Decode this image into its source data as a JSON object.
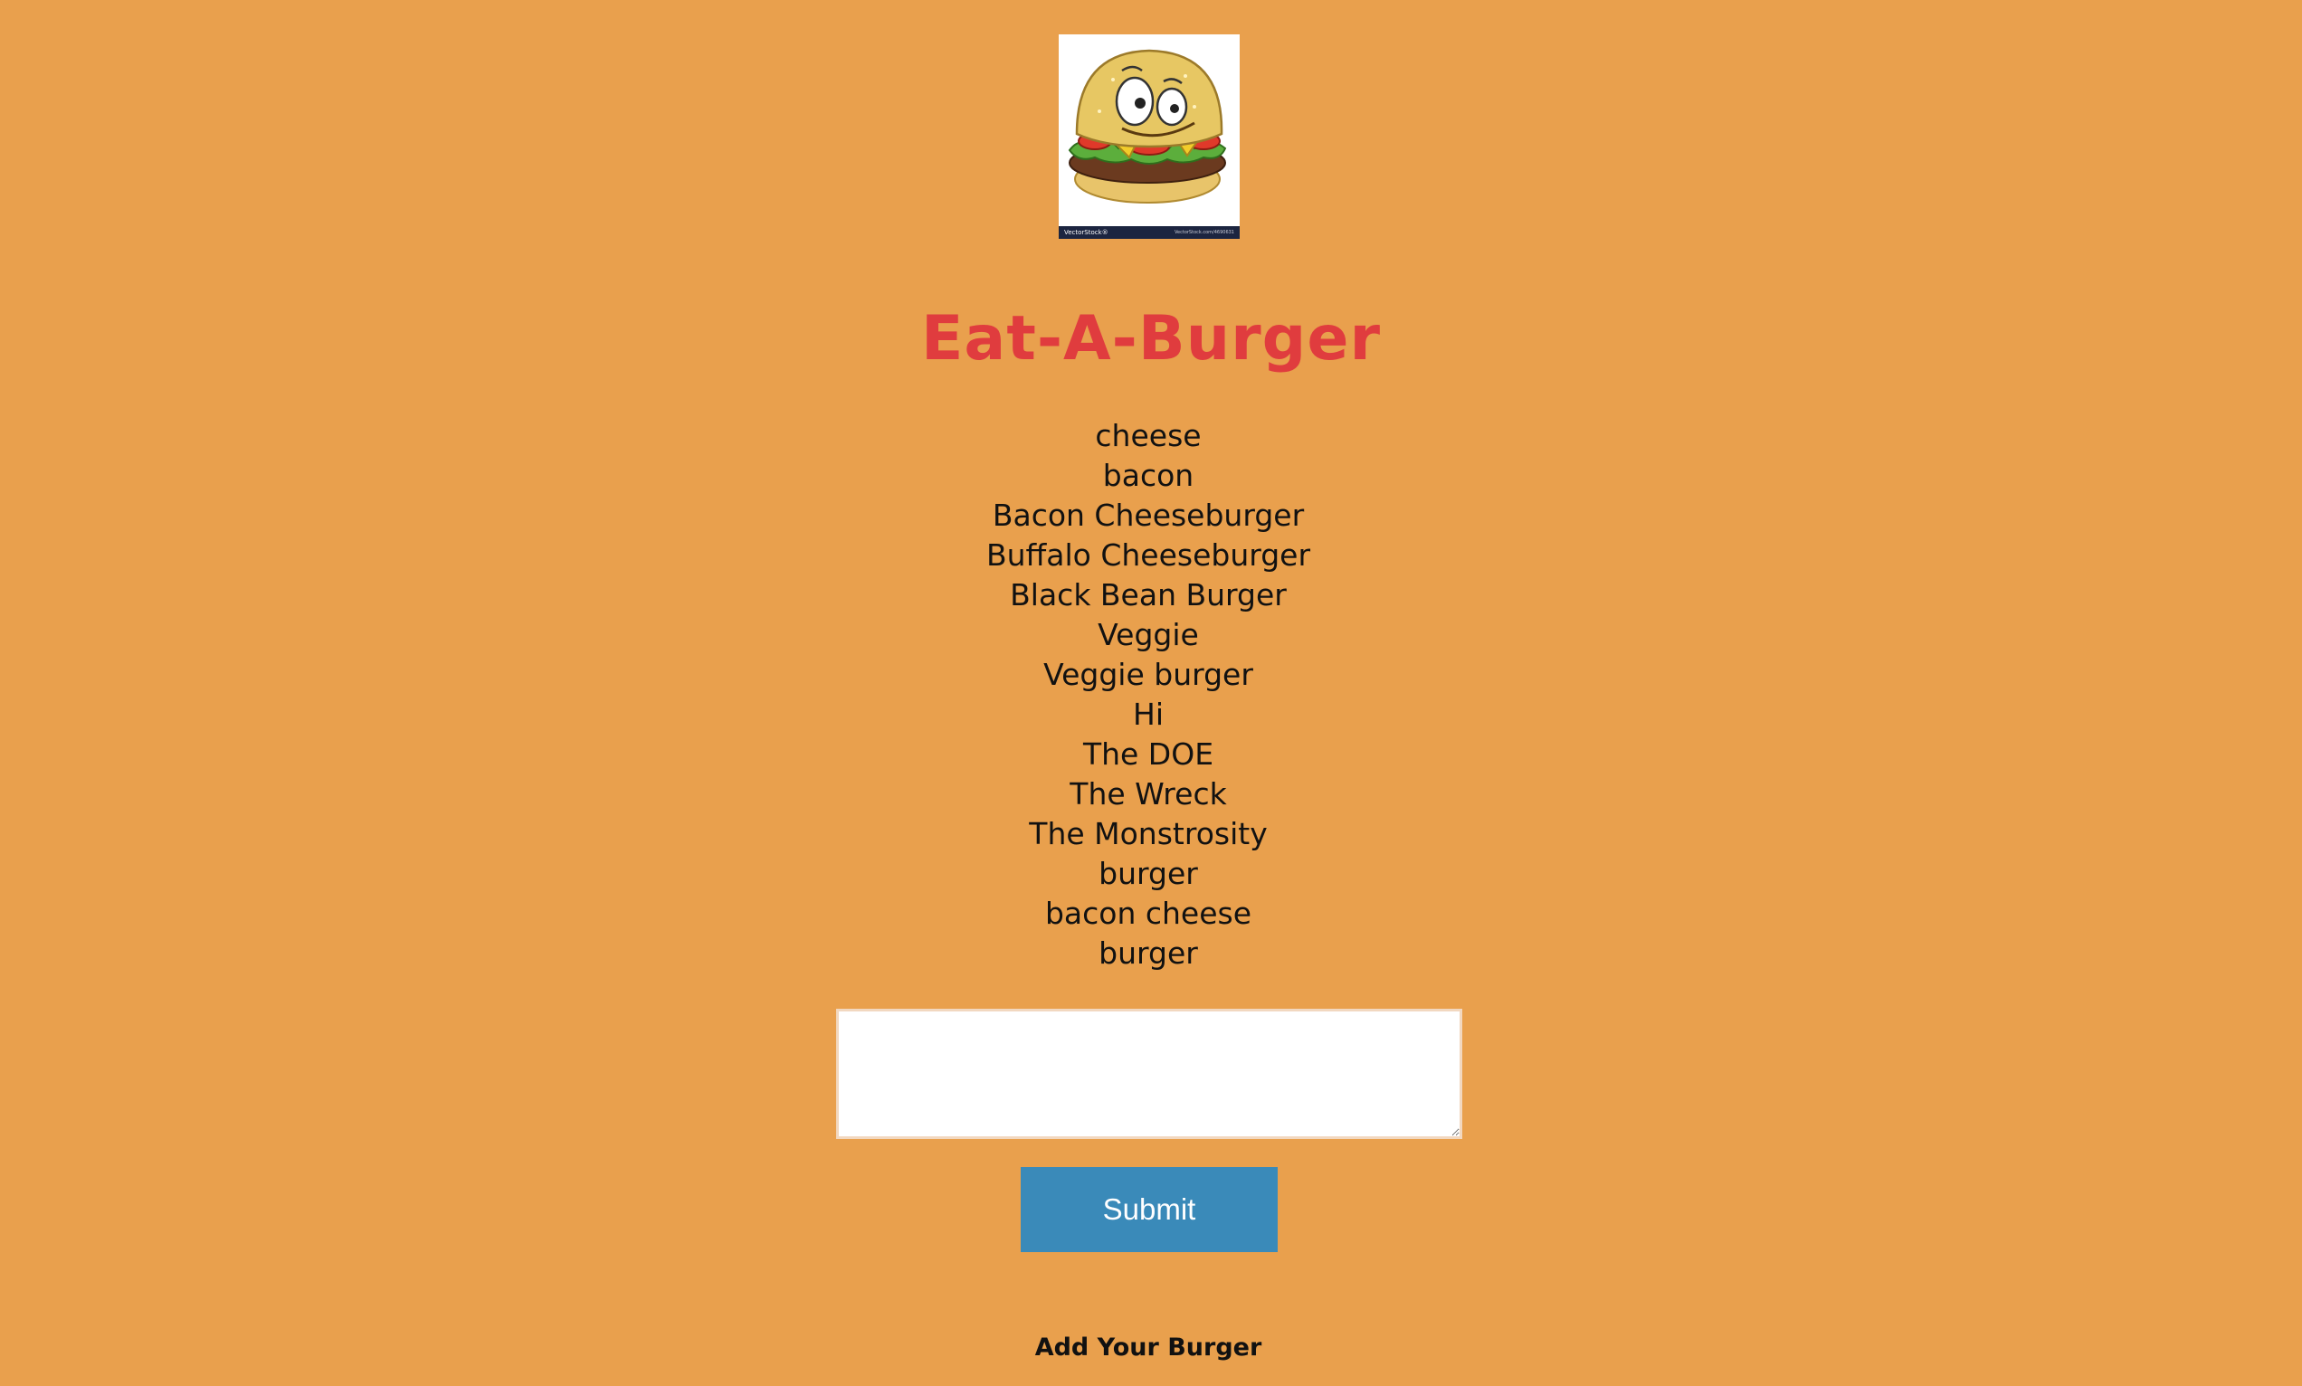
{
  "app": {
    "title": "Eat-A-Burger",
    "title_color": "#e03c3e",
    "background_color": "#e9a04d"
  },
  "logo": {
    "icon": "cartoon-burger-icon",
    "watermark_left": "VectorStock®",
    "watermark_right": "VectorStock.com/4690631"
  },
  "burgers": [
    "cheese",
    "bacon",
    "Bacon Cheeseburger",
    "Buffalo Cheeseburger",
    "Black Bean Burger",
    "Veggie",
    "Veggie burger",
    "Hi",
    "The DOE",
    "The Wreck",
    "The Monstrosity",
    "burger",
    "bacon cheese",
    "burger"
  ],
  "form": {
    "input_value": "",
    "submit_label": "Submit",
    "submit_color": "#3a8ab9",
    "add_label": "Add Your Burger"
  }
}
